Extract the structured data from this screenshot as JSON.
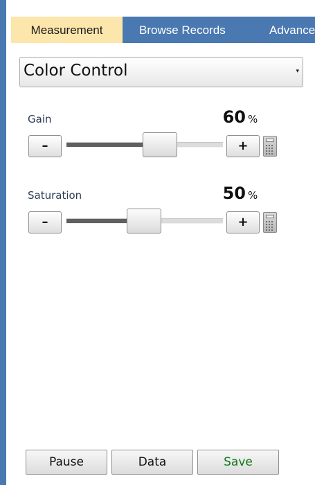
{
  "tabs": [
    {
      "label": "Measurement",
      "active": true
    },
    {
      "label": "Browse Records",
      "active": false
    },
    {
      "label": "Advance",
      "active": false
    }
  ],
  "mode_select": {
    "value": "Color Control"
  },
  "controls": {
    "gain": {
      "label": "Gain",
      "value": "60",
      "unit": "%",
      "minus": "–",
      "plus": "+",
      "slider_fraction": 0.6
    },
    "saturation": {
      "label": "Saturation",
      "value": "50",
      "unit": "%",
      "minus": "–",
      "plus": "+",
      "slider_fraction": 0.5
    }
  },
  "actions": {
    "pause": "Pause",
    "data": "Data",
    "save": "Save"
  },
  "colors": {
    "accent_blue": "#4a78b0",
    "active_tab": "#fde6ab",
    "save_text": "#0f7a1a"
  },
  "icons": {
    "dropdown": "dropdown-arrow-icon",
    "calculator": "calculator-icon"
  }
}
